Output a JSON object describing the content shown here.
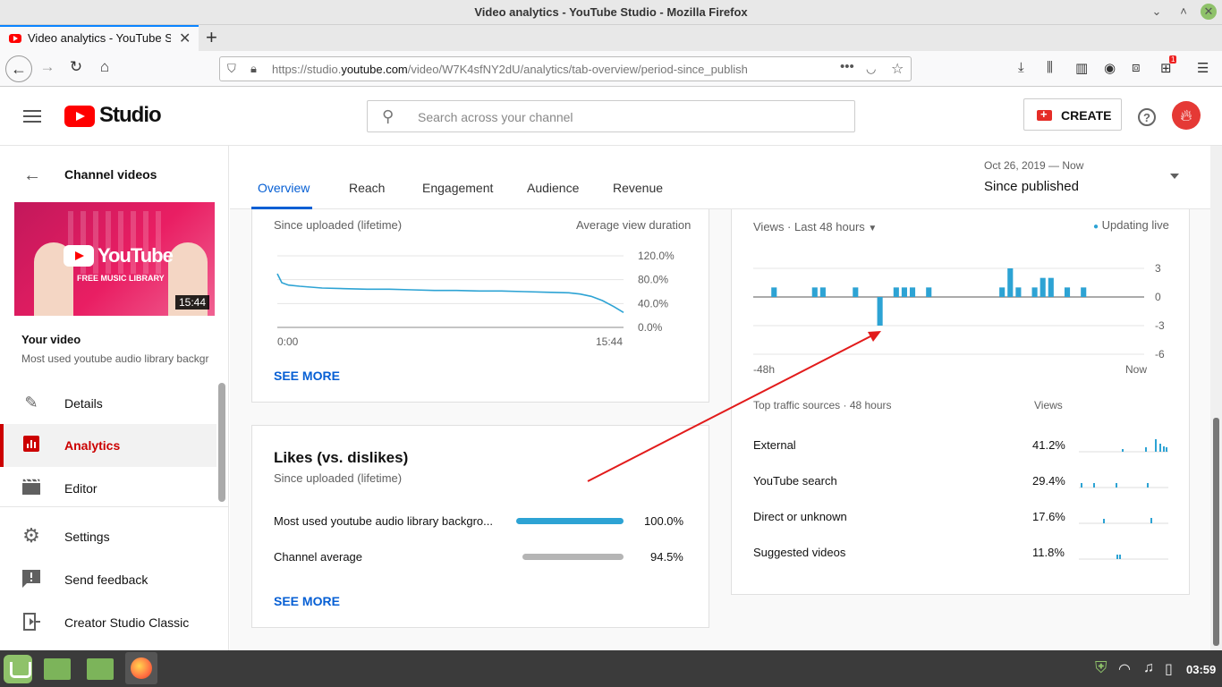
{
  "window": {
    "title": "Video analytics - YouTube Studio - Mozilla Firefox"
  },
  "browser": {
    "tab_title": "Video analytics - YouTube S",
    "url_prefix": "https://studio.",
    "url_domain": "youtube.com",
    "url_path": "/video/W7K4sfNY2dU/analytics/tab-overview/period-since_publish",
    "notification_count": "1"
  },
  "header": {
    "logo_text": "Studio",
    "search_placeholder": "Search across your channel",
    "create_label": "CREATE",
    "help_label": "?"
  },
  "sidebar": {
    "back_title": "Channel videos",
    "thumb_brand": "YouTube",
    "thumb_caption": "FREE MUSIC LIBRARY",
    "thumb_duration": "15:44",
    "your_video": "Your video",
    "video_title": "Most used youtube audio library background music",
    "items": [
      {
        "label": "Details",
        "icon": "pencil-icon"
      },
      {
        "label": "Analytics",
        "icon": "analytics-icon",
        "active": true
      },
      {
        "label": "Editor",
        "icon": "clapperboard-icon"
      },
      {
        "label": "Settings",
        "icon": "gear-icon"
      },
      {
        "label": "Send feedback",
        "icon": "feedback-icon"
      },
      {
        "label": "Creator Studio Classic",
        "icon": "exit-icon"
      }
    ]
  },
  "tabs": [
    "Overview",
    "Reach",
    "Engagement",
    "Audience",
    "Revenue"
  ],
  "period": {
    "range": "Oct 26, 2019 — Now",
    "label": "Since published"
  },
  "retention": {
    "heading_fragment": "(...)",
    "subtitle": "Since uploaded (lifetime)",
    "metric": "Average view duration",
    "y_ticks": [
      "120.0%",
      "80.0%",
      "40.0%",
      "0.0%"
    ],
    "x_start": "0:00",
    "x_end": "15:44",
    "see_more": "SEE MORE",
    "chart_data": {
      "type": "line",
      "y_range": [
        0,
        120
      ],
      "x": [
        0,
        0.2,
        0.5,
        1,
        2,
        3,
        4,
        5,
        6,
        7,
        8,
        9,
        10,
        11,
        12,
        13,
        13.5,
        14,
        14.5,
        15,
        15.44
      ],
      "y": [
        90,
        75,
        71,
        69,
        66,
        65,
        64,
        64,
        63,
        62,
        62,
        61,
        61,
        60,
        59,
        58,
        56,
        52,
        45,
        35,
        25
      ]
    }
  },
  "likes": {
    "title": "Likes (vs. dislikes)",
    "subtitle": "Since uploaded (lifetime)",
    "rows": [
      {
        "label": "Most used youtube audio library backgro...",
        "value": "100.0%",
        "fraction": 1.0,
        "color": "#2da3d4"
      },
      {
        "label": "Channel average",
        "value": "94.5%",
        "fraction": 0.945,
        "color": "#b5b5b5"
      }
    ],
    "see_more": "SEE MORE"
  },
  "realtime": {
    "filter": "Views · Last 48 hours",
    "live": "Updating live",
    "y_ticks": [
      "3",
      "0",
      "-3",
      "-6"
    ],
    "x_start": "-48h",
    "x_end": "Now",
    "chart_data": {
      "type": "bar",
      "y_range": [
        -6,
        3
      ],
      "hours": [
        2,
        7,
        8,
        12,
        15,
        17,
        18,
        19,
        21,
        30,
        31,
        32,
        34,
        35,
        36,
        38,
        40
      ],
      "values": [
        1,
        1,
        1,
        1,
        -3,
        1,
        1,
        1,
        1,
        1,
        3,
        1,
        1,
        2,
        2,
        1,
        1
      ]
    },
    "traffic_title": "Top traffic sources · 48 hours",
    "traffic_views_label": "Views",
    "sources": [
      {
        "name": "External",
        "pct": "41.2%"
      },
      {
        "name": "YouTube search",
        "pct": "29.4%"
      },
      {
        "name": "Direct or unknown",
        "pct": "17.6%"
      },
      {
        "name": "Suggested videos",
        "pct": "11.8%"
      }
    ]
  },
  "taskbar": {
    "clock": "03:59"
  }
}
